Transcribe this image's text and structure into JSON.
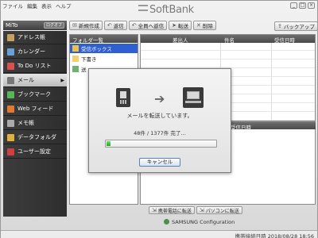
{
  "menu": [
    "ファイル",
    "編集",
    "表示",
    "ヘルプ"
  ],
  "brand": "SoftBank",
  "window_controls": [
    "_",
    "□",
    "×"
  ],
  "user": {
    "name": "MiTo",
    "logoff_label": "ログオフ"
  },
  "sidebar": {
    "items": [
      {
        "label": "アドレス帳",
        "icon": "address-book-icon",
        "color": "#c8a060"
      },
      {
        "label": "カレンダー",
        "icon": "calendar-icon",
        "color": "#6aa0d8"
      },
      {
        "label": "To Do リスト",
        "icon": "todo-icon",
        "color": "#d85050"
      },
      {
        "label": "メール",
        "icon": "mail-icon",
        "color": "#777777",
        "selected": true,
        "arrow": "▶"
      },
      {
        "label": "ブックマーク",
        "icon": "bookmark-icon",
        "color": "#58b858"
      },
      {
        "label": "Web フィード",
        "icon": "web-feed-icon",
        "color": "#e07a30"
      },
      {
        "label": "メモ帳",
        "icon": "memo-icon",
        "color": "#aaaaaa"
      },
      {
        "label": "データフォルダ",
        "icon": "data-folder-icon",
        "color": "#e0b040"
      },
      {
        "label": "ユーザー設定",
        "icon": "user-settings-icon",
        "color": "#d04040"
      }
    ]
  },
  "toolbar": {
    "buttons": [
      {
        "label": "新規作成",
        "icon": "new-icon",
        "glyph": "✉"
      },
      {
        "label": "返信",
        "icon": "reply-icon",
        "glyph": "↶"
      },
      {
        "label": "全員へ返信",
        "icon": "reply-all-icon",
        "glyph": "↶"
      },
      {
        "label": "転送",
        "icon": "forward-icon",
        "glyph": "➤"
      },
      {
        "label": "削除",
        "icon": "delete-icon",
        "glyph": "✕"
      }
    ],
    "backup_label": "バックアップ",
    "backup_glyph": "⇪"
  },
  "folders": {
    "header": "フォルダ一覧",
    "items": [
      {
        "label": "受信ボックス",
        "selected": true,
        "color": "#f0c040"
      },
      {
        "label": "下書き",
        "selected": false,
        "color": "#f0d070"
      },
      {
        "label": "送",
        "selected": false,
        "color": "#70b070"
      }
    ]
  },
  "mail_list": {
    "columns": [
      "",
      "",
      "差出人",
      "件名",
      "受信日時"
    ],
    "row_count": 9
  },
  "preview": {
    "header": "受信日時"
  },
  "bottom_buttons": [
    {
      "label": "携帯電話に転送",
      "glyph": "⇲"
    },
    {
      "label": "パソコンに転送",
      "glyph": "⇲"
    }
  ],
  "samsung_label": "SAMSUNG Configuration",
  "status": {
    "text": "携帯接続日時 2018/08/28 18:56"
  },
  "dialog": {
    "message": "メールを転送しています。",
    "count_text": "48件  /  1377件 完了…",
    "progress": 0.034,
    "arrow": "➔",
    "cancel_label": "キャンセル"
  }
}
